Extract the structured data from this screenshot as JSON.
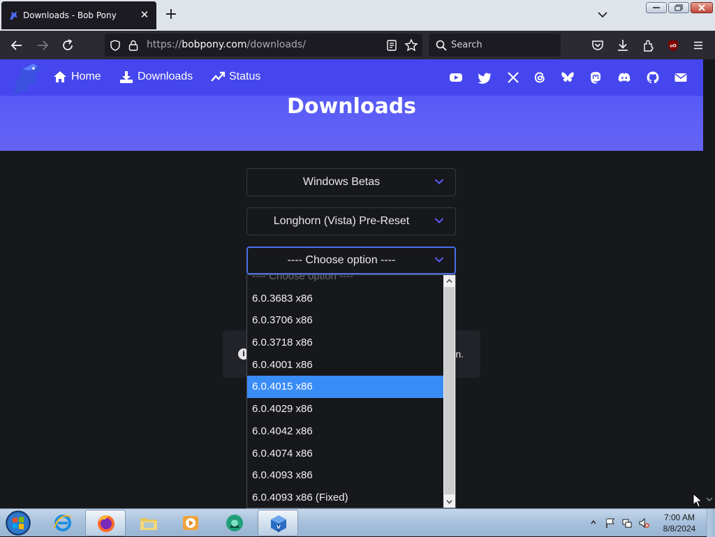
{
  "browser": {
    "tab_title": "Downloads - Bob Pony",
    "url_prefix": "https://",
    "url_host": "bobpony.com",
    "url_path": "/downloads/",
    "search_placeholder": "Search"
  },
  "site": {
    "nav": [
      {
        "label": "Home",
        "icon": "home-icon"
      },
      {
        "label": "Downloads",
        "icon": "download-icon"
      },
      {
        "label": "Status",
        "icon": "trend-icon"
      }
    ],
    "socials": [
      "youtube-icon",
      "twitter-icon",
      "x-icon",
      "threads-icon",
      "bluesky-icon",
      "mastodon-icon",
      "discord-icon",
      "github-icon",
      "mail-icon"
    ],
    "page_title": "Downloads",
    "accent_color": "#4546ee"
  },
  "selects": {
    "category": "Windows Betas",
    "product": "Longhorn (Vista) Pre-Reset",
    "build": "---- Choose option ----"
  },
  "info": {
    "tail_text": "n."
  },
  "dropdown": {
    "options": [
      "---- Choose option ----",
      "6.0.3683 x86",
      "6.0.3706 x86",
      "6.0.3718 x86",
      "6.0.4001 x86",
      "6.0.4015 x86",
      "6.0.4029 x86",
      "6.0.4042 x86",
      "6.0.4074 x86",
      "6.0.4093 x86",
      "6.0.4093 x86 (Fixed)"
    ],
    "highlighted": "6.0.4015 x86",
    "highlight_color": "#3a8cf7"
  },
  "taskbar": {
    "apps": [
      "internet-explorer-icon",
      "firefox-icon",
      "file-explorer-icon",
      "media-player-icon",
      "app-icon",
      "virtualbox-icon"
    ],
    "active_app": "firefox-icon",
    "time": "7:00 AM",
    "date": "8/8/2024"
  }
}
